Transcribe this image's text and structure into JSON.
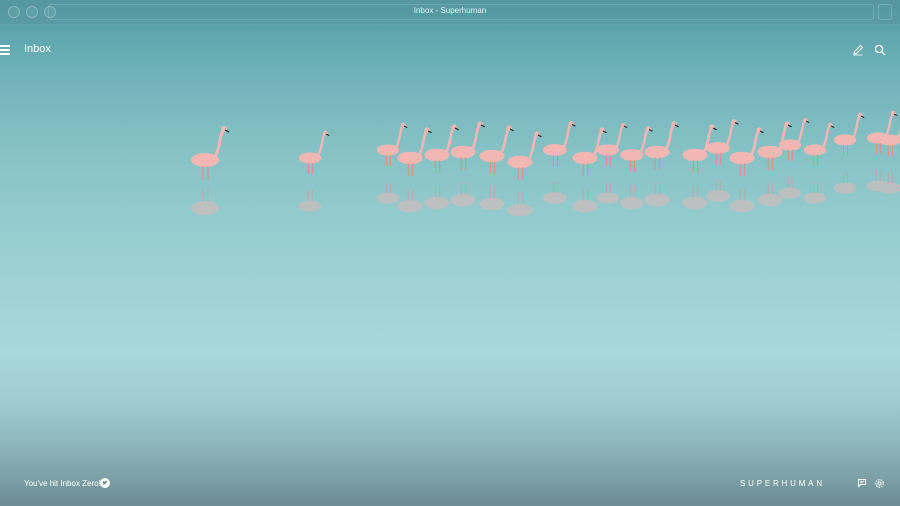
{
  "window": {
    "title": "Inbox - Superhuman"
  },
  "header": {
    "title": "Inbox"
  },
  "footer": {
    "status": "You've hit Inbox Zero!",
    "brand": "SUPERHUMAN"
  },
  "icons": {
    "menu": "hamburger-icon",
    "compose": "pencil-icon",
    "search": "search-icon",
    "share": "twitter-bird-icon",
    "flag": "flag-icon",
    "settings": "gear-icon"
  },
  "colors": {
    "sky": "#4f9aa4",
    "water": "#a2d3d6",
    "flamingo": "#f2b7b2",
    "flamingo_dark": "#e08f8a"
  }
}
